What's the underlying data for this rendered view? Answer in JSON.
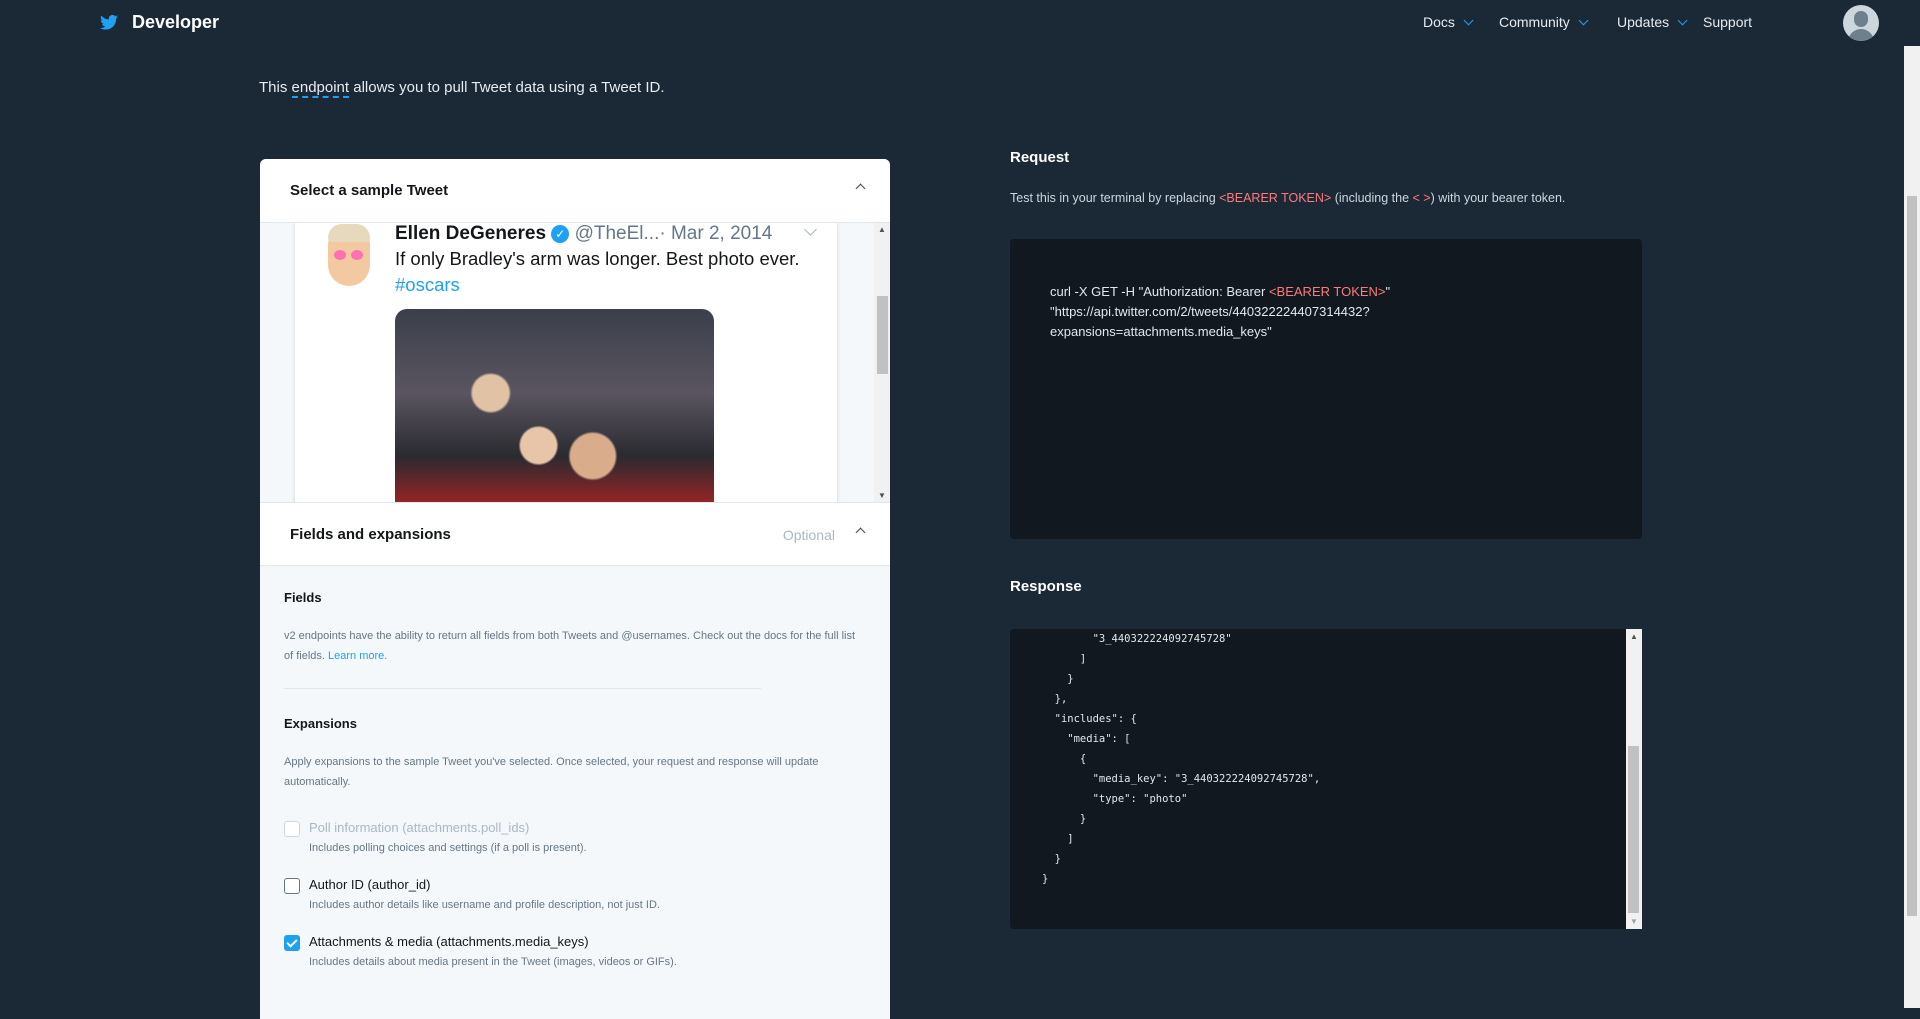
{
  "header": {
    "brand": "Developer",
    "nav": [
      {
        "label": "Docs",
        "has_dropdown": true
      },
      {
        "label": "Community",
        "has_dropdown": true
      },
      {
        "label": "Updates",
        "has_dropdown": true
      },
      {
        "label": "Support",
        "has_dropdown": false
      }
    ],
    "accent": "#1da1f2"
  },
  "intro": {
    "prefix": "This ",
    "link": "endpoint",
    "suffix": " allows you to pull Tweet data using a Tweet ID."
  },
  "sample": {
    "title": "Select a sample Tweet",
    "tweet": {
      "name": "Ellen DeGeneres",
      "handle": "@TheEl...",
      "date": "· Mar 2, 2014",
      "text": "If only Bradley's arm was longer. Best photo ever. ",
      "hashtag": "#oscars"
    }
  },
  "fields_panel": {
    "title": "Fields and expansions",
    "optional": "Optional",
    "fields_heading": "Fields",
    "fields_desc": "v2 endpoints have the ability to return all fields from both Tweets and @usernames. Check out the docs for the full list of fields. ",
    "learn_more": "Learn more.",
    "expansions_heading": "Expansions",
    "expansions_desc": "Apply expansions to the sample Tweet you've selected. Once selected, your request and response will update automatically.",
    "options": [
      {
        "label": "Poll information (attachments.poll_ids)",
        "desc": "Includes polling choices and settings (if a poll is present).",
        "checked": false,
        "disabled": true
      },
      {
        "label": "Author ID (author_id)",
        "desc": "Includes author details like username and profile description, not just ID.",
        "checked": false,
        "disabled": false
      },
      {
        "label": "Attachments & media (attachments.media_keys)",
        "desc": "Includes details about media present in the Tweet (images, videos or GIFs).",
        "checked": true,
        "disabled": false
      }
    ]
  },
  "request": {
    "title": "Request",
    "hint_prefix": "Test this in your terminal by replacing ",
    "hint_token": "<BEARER TOKEN>",
    "hint_mid": " (including the ",
    "hint_brackets": "< >",
    "hint_suffix": ") with your bearer token.",
    "line1_prefix": "curl -X GET -H \"Authorization: Bearer ",
    "line1_token": "<BEARER TOKEN>",
    "line1_suffix": "\"",
    "line2": "\"https://api.twitter.com/2/tweets/440322224407314432?",
    "line3": "expansions=attachments.media_keys\""
  },
  "response": {
    "title": "Response",
    "body": "        \"3_440322224092745728\"\n      ]\n    }\n  },\n  \"includes\": {\n    \"media\": [\n      {\n        \"media_key\": \"3_440322224092745728\",\n        \"type\": \"photo\"\n      }\n    ]\n  }\n}"
  }
}
